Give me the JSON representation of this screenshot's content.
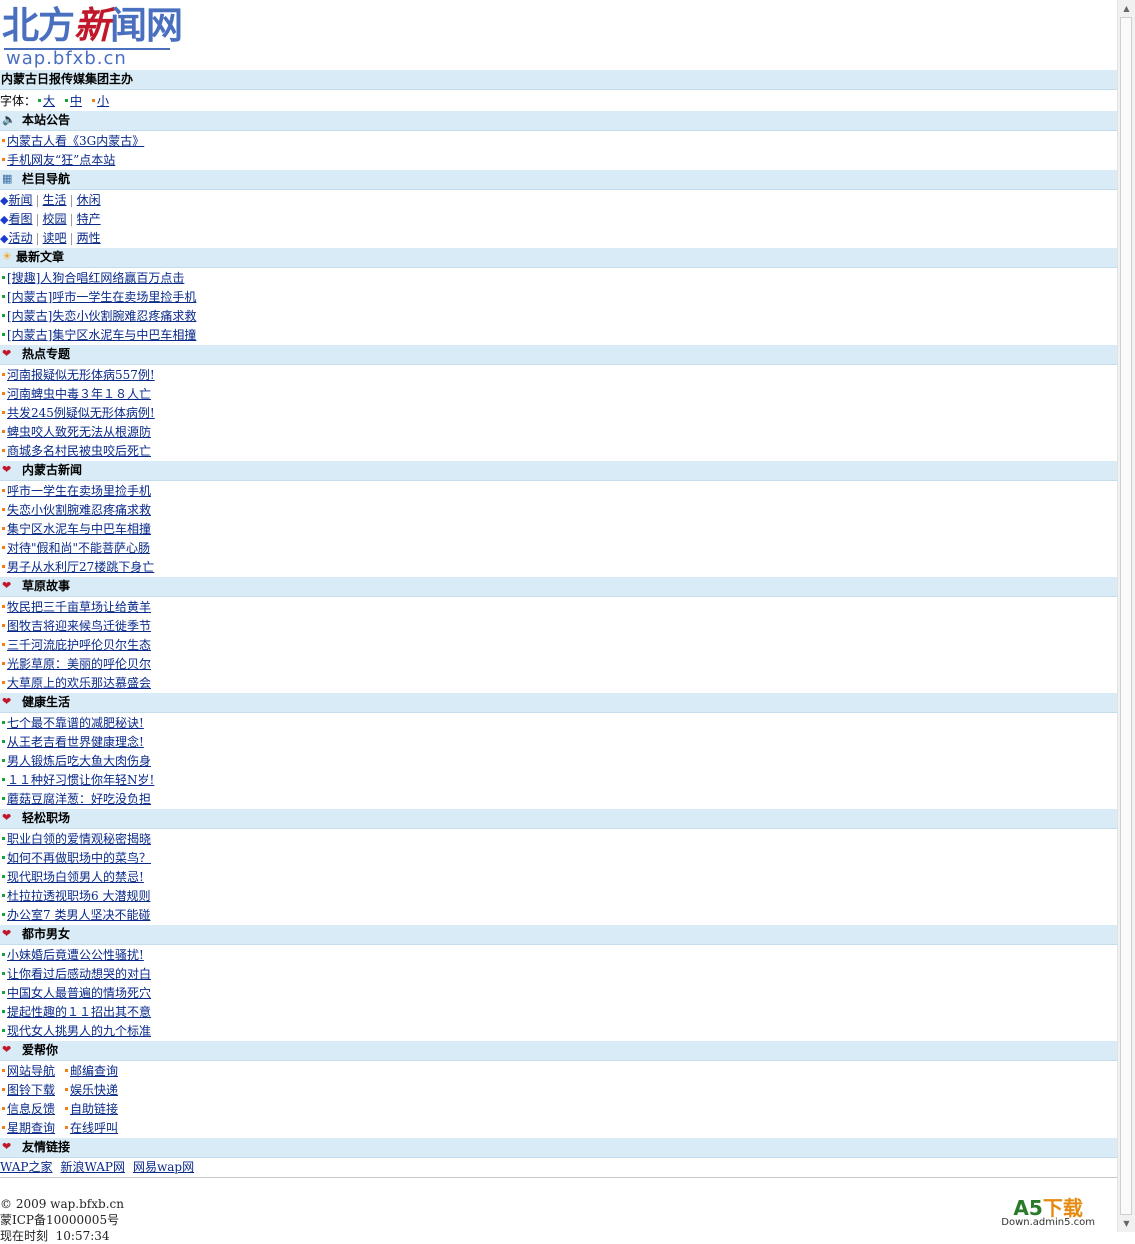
{
  "logo": {
    "cn_part1": "北方",
    "cn_part2": "新",
    "cn_part3": "闻网",
    "en": "wap.bfxb.cn"
  },
  "sponsor": "内蒙古日报传媒集团主办",
  "font_size": {
    "label": "字体：",
    "options": [
      "大",
      "中",
      "小"
    ]
  },
  "notice": {
    "title": "本站公告",
    "items": [
      "内蒙古人看《3G内蒙古》",
      "手机网友“狂”点本站"
    ]
  },
  "nav": {
    "title": "栏目导航",
    "rows": [
      [
        "新闻",
        "生活",
        "休闲"
      ],
      [
        "看图",
        "校园",
        "特产"
      ],
      [
        "活动",
        "读吧",
        "两性"
      ]
    ]
  },
  "latest": {
    "title": "最新文章",
    "items": [
      "[搜趣]人狗合唱红网络赢百万点击",
      "[内蒙古]呼市一学生在卖场里捡手机",
      "[内蒙古]失恋小伙割腕难忍疼痛求救",
      "[内蒙古]集宁区水泥车与中巴车相撞"
    ]
  },
  "sections": [
    {
      "title": "热点专题",
      "bullet": "o",
      "items": [
        "河南报疑似无形体病557例!",
        "河南蜱虫中毒３年１８人亡",
        "共发245例疑似无形体病例!",
        "蜱虫咬人致死无法从根源防",
        "商城多名村民被虫咬后死亡"
      ]
    },
    {
      "title": "内蒙古新闻",
      "bullet": "o",
      "items": [
        "呼市一学生在卖场里捡手机",
        "失恋小伙割腕难忍疼痛求救",
        "集宁区水泥车与中巴车相撞",
        "对待\"假和尚\"不能菩萨心肠",
        "男子从水利厅27楼跳下身亡"
      ]
    },
    {
      "title": "草原故事",
      "bullet": "o",
      "items": [
        "牧民把三千亩草场让给黄羊",
        "图牧吉将迎来候鸟迁徙季节",
        "三千河流庇护呼伦贝尔生态",
        "光影草原：美丽的呼伦贝尔",
        "大草原上的欢乐那达慕盛会"
      ]
    },
    {
      "title": "健康生活",
      "bullet": "g",
      "items": [
        "七个最不靠谱的减肥秘诀!",
        "从王老吉看世界健康理念!",
        "男人锻炼后吃大鱼大肉伤身",
        "１１种好习惯让你年轻N岁!",
        "蘑菇豆腐洋葱：好吃没负担"
      ]
    },
    {
      "title": "轻松职场",
      "bullet": "g",
      "items": [
        "职业白领的爱情观秘密揭晓",
        "如何不再做职场中的菜鸟？",
        "现代职场白领男人的禁忌!",
        "杜拉拉透视职场6 大潜规则",
        "办公室7 类男人坚决不能碰"
      ]
    },
    {
      "title": "都市男女",
      "bullet": "g",
      "items": [
        "小妹婚后竟遭公公性骚扰!",
        "让你看过后感动想哭的对白",
        "中国女人最普遍的情场死穴",
        "提起性趣的１１招出其不意",
        "现代女人挑男人的九个标准"
      ]
    }
  ],
  "help": {
    "title": "爱帮你",
    "rows": [
      [
        "网站导航",
        "邮编查询"
      ],
      [
        "图铃下载",
        "娱乐快递"
      ],
      [
        "信息反馈",
        "自助链接"
      ],
      [
        "星期查询",
        "在线呼叫"
      ]
    ]
  },
  "friends": {
    "title": "友情链接",
    "items": [
      "WAP之家",
      "新浪WAP网",
      "网易wap网"
    ]
  },
  "footer": {
    "copyright": "© 2009 wap.bfxb.cn",
    "icp": "蒙ICP备10000005号",
    "time_label": "现在时刻",
    "time": "10:57:34"
  },
  "watermark": {
    "big": "A5下载",
    "small": "Down.admin5.com"
  },
  "colors": {
    "bar_bg": "#d8ebf6",
    "link": "#0a2a8a",
    "bullet_orange": "#f57d16",
    "bullet_green": "#18a23d",
    "logo_blue": "#4a6fbf",
    "logo_red": "#c0182a"
  }
}
